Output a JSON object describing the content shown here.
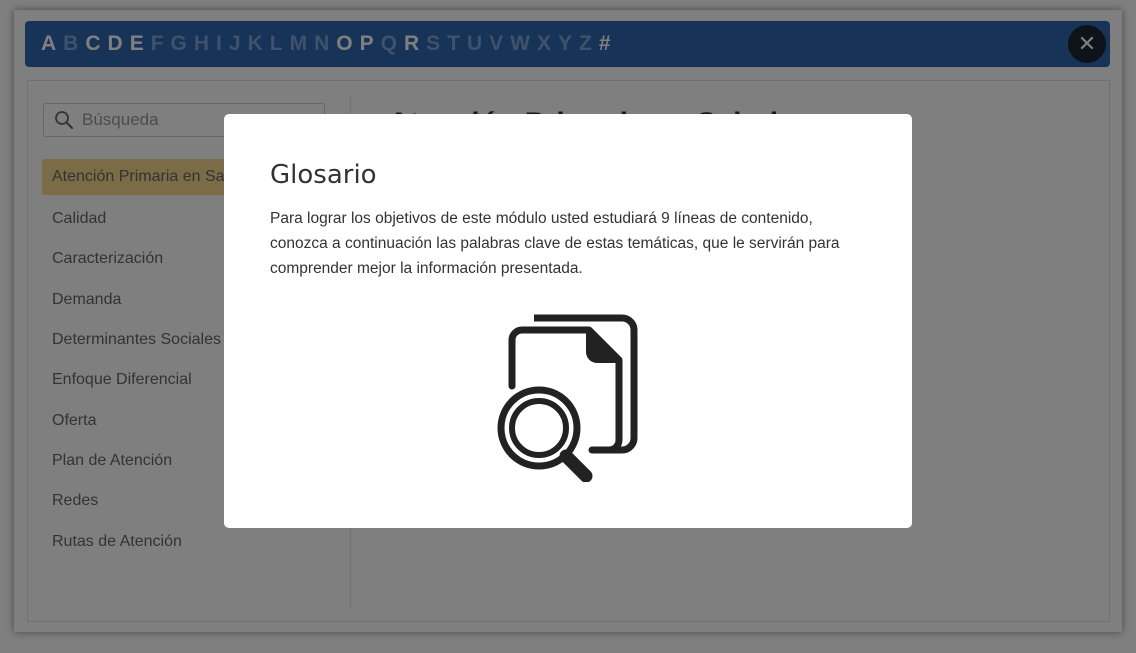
{
  "alphabet": [
    {
      "char": "A",
      "active": true
    },
    {
      "char": "B",
      "active": false
    },
    {
      "char": "C",
      "active": true
    },
    {
      "char": "D",
      "active": true
    },
    {
      "char": "E",
      "active": true
    },
    {
      "char": "F",
      "active": false
    },
    {
      "char": "G",
      "active": false
    },
    {
      "char": "H",
      "active": false
    },
    {
      "char": "I",
      "active": false
    },
    {
      "char": "J",
      "active": false
    },
    {
      "char": "K",
      "active": false
    },
    {
      "char": "L",
      "active": false
    },
    {
      "char": "M",
      "active": false
    },
    {
      "char": "N",
      "active": false
    },
    {
      "char": "O",
      "active": true
    },
    {
      "char": "P",
      "active": true
    },
    {
      "char": "Q",
      "active": false
    },
    {
      "char": "R",
      "active": true
    },
    {
      "char": "S",
      "active": false
    },
    {
      "char": "T",
      "active": false
    },
    {
      "char": "U",
      "active": false
    },
    {
      "char": "V",
      "active": false
    },
    {
      "char": "W",
      "active": false
    },
    {
      "char": "X",
      "active": false
    },
    {
      "char": "Y",
      "active": false
    },
    {
      "char": "Z",
      "active": false
    },
    {
      "char": "#",
      "active": true
    }
  ],
  "colors": {
    "bar_bg": "#2f68b1",
    "letter_active": "#ffffff",
    "letter_inactive": "#7ea2d6",
    "selected_item_bg": "#f6d98f",
    "close_bg": "#1c2433"
  },
  "close_button": {
    "label": "✕",
    "icon": "close-icon"
  },
  "search": {
    "placeholder": "Búsqueda",
    "value": "",
    "icon": "search-icon"
  },
  "terms": [
    {
      "label": "Atención Primaria en Salud",
      "selected": true
    },
    {
      "label": "Calidad",
      "selected": false
    },
    {
      "label": "Caracterización",
      "selected": false
    },
    {
      "label": "Demanda",
      "selected": false
    },
    {
      "label": "Determinantes Sociales",
      "selected": false
    },
    {
      "label": "Enfoque Diferencial",
      "selected": false
    },
    {
      "label": "Oferta",
      "selected": false
    },
    {
      "label": "Plan de Atención",
      "selected": false
    },
    {
      "label": "Redes",
      "selected": false
    },
    {
      "label": "Rutas de Atención",
      "selected": false
    }
  ],
  "detail": {
    "title": "Atención Primaria en Salud"
  },
  "modal": {
    "title": "Glosario",
    "text": "Para lograr los objetivos de este módulo usted estudiará 9 líneas de contenido, conozca a continuación las palabras clave de estas temáticas, que le servirán para comprender mejor la información presentada.",
    "icon": "document-search-icon"
  }
}
